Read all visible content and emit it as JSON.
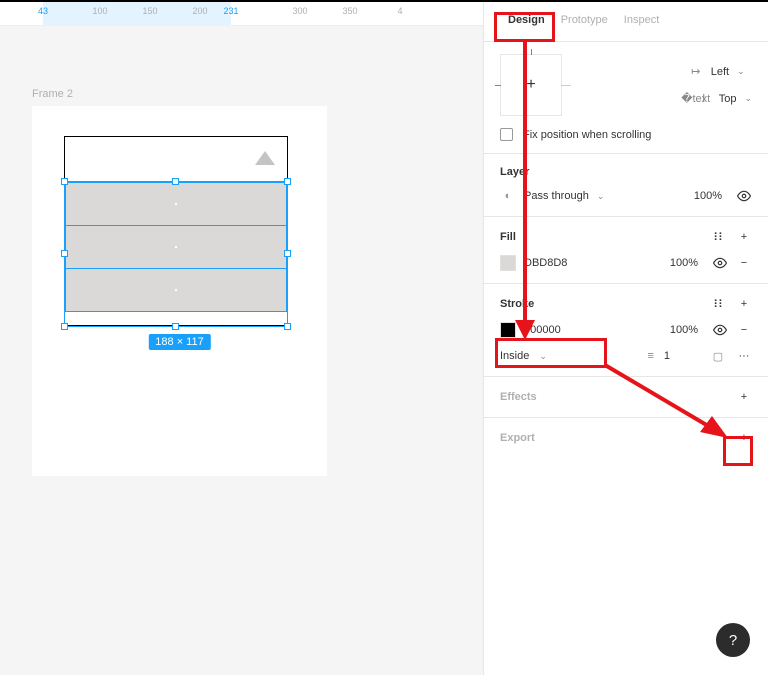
{
  "ruler": {
    "sel_start": 43,
    "sel_end": 231,
    "ticks": [
      {
        "label": "43",
        "pos": 43,
        "active": true
      },
      {
        "label": "100",
        "pos": 100,
        "active": false
      },
      {
        "label": "150",
        "pos": 150,
        "active": false
      },
      {
        "label": "200",
        "pos": 200,
        "active": false
      },
      {
        "label": "231",
        "pos": 231,
        "active": true
      },
      {
        "label": "300",
        "pos": 300,
        "active": false
      },
      {
        "label": "350",
        "pos": 350,
        "active": false
      },
      {
        "label": "4",
        "pos": 400,
        "active": false
      }
    ]
  },
  "canvas": {
    "frame_label": "Frame 2",
    "selection_dim": "188 × 117"
  },
  "panel": {
    "tabs": {
      "design": "Design",
      "prototype": "Prototype",
      "inspect": "Inspect"
    },
    "constraints": {
      "h": "Left",
      "v": "Top"
    },
    "fix_position_label": "Fix position when scrolling",
    "layer": {
      "title": "Layer",
      "mode": "Pass through",
      "opacity": "100%"
    },
    "fill": {
      "title": "Fill",
      "hex": "DBD8D8",
      "swatch": "#DBD8D8",
      "opacity": "100%"
    },
    "stroke": {
      "title": "Stroke",
      "hex": "000000",
      "swatch": "#000000",
      "opacity": "100%",
      "align": "Inside",
      "weight": "1"
    },
    "effects_title": "Effects",
    "export_title": "Export"
  }
}
